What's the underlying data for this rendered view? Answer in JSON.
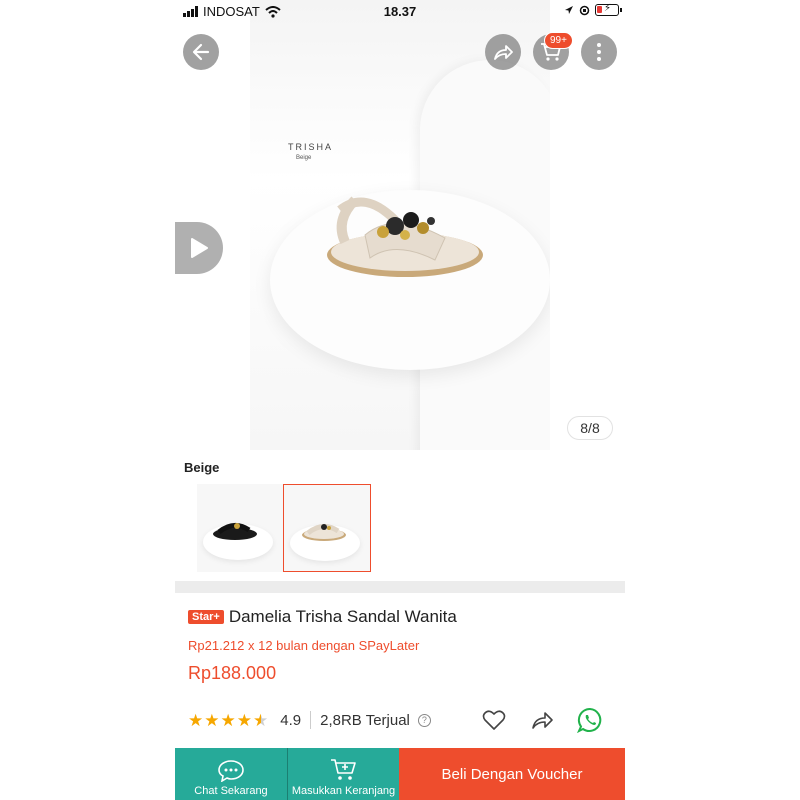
{
  "status_bar": {
    "carrier": "INDOSAT",
    "time": "18.37"
  },
  "hero": {
    "brand_text": "TRISHA",
    "brand_sub": "Beige",
    "image_counter": "8/8",
    "cart_badge": "99+"
  },
  "variant": {
    "label": "Beige",
    "selected_index": 1
  },
  "product": {
    "badge": "Star+",
    "title": "Damelia Trisha Sandal Wanita",
    "paylater": "Rp21.212 x 12 bulan dengan SPayLater",
    "price": "Rp188.000",
    "rating": "4.9",
    "rating_value": 4.5,
    "sold": "2,8RB Terjual"
  },
  "bottom_bar": {
    "chat_label": "Chat Sekarang",
    "add_cart_label": "Masukkan Keranjang",
    "buy_label": "Beli Dengan Voucher"
  },
  "colors": {
    "accent": "#ee4d2d",
    "teal": "#26aa99",
    "star": "#f6a700"
  },
  "icons": [
    "back-arrow-icon",
    "share-icon",
    "cart-icon",
    "more-icon",
    "play-icon",
    "heart-icon",
    "whatsapp-icon",
    "help-icon",
    "chat-icon",
    "add-cart-icon"
  ]
}
